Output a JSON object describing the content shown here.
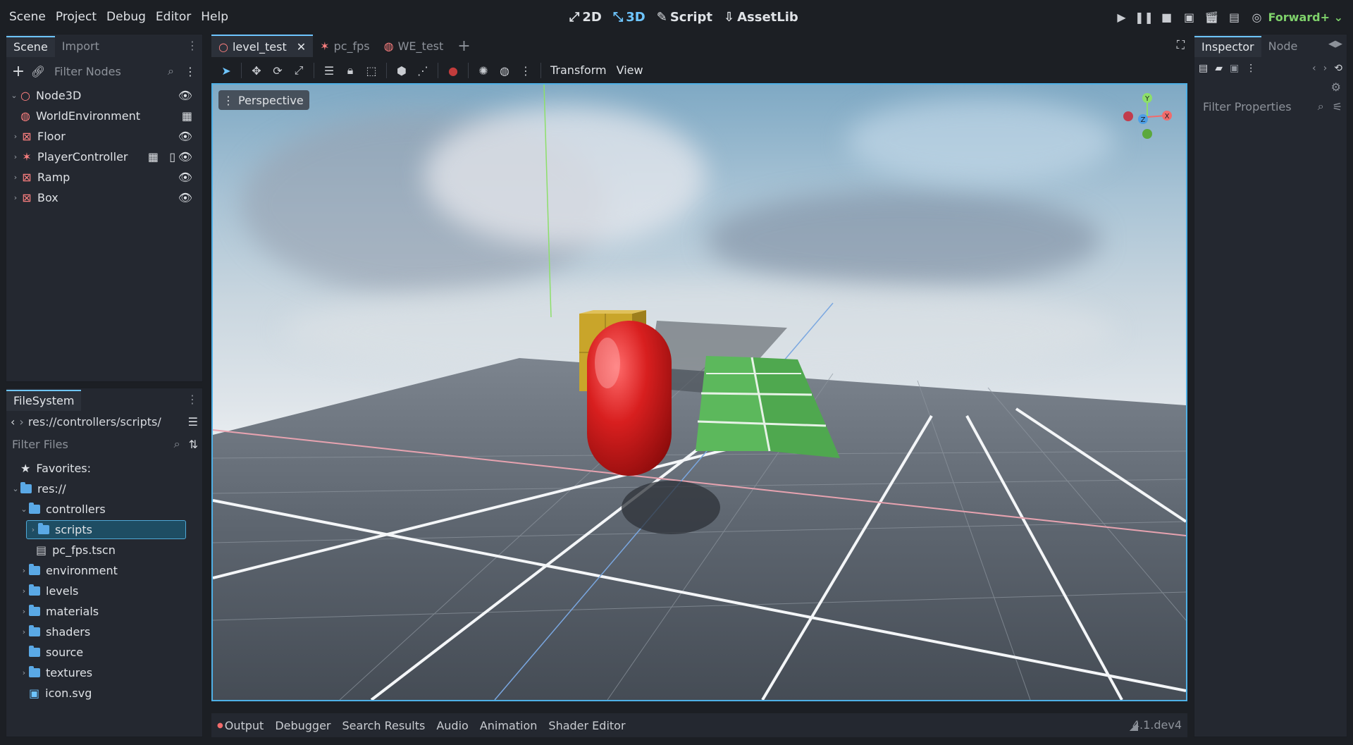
{
  "menu": [
    "Scene",
    "Project",
    "Debug",
    "Editor",
    "Help"
  ],
  "workspaces": [
    {
      "label": "2D",
      "active": false
    },
    {
      "label": "3D",
      "active": true
    },
    {
      "label": "Script",
      "active": false
    },
    {
      "label": "AssetLib",
      "active": false
    }
  ],
  "renderer": "Forward+",
  "scene_dock": {
    "tabs": [
      "Scene",
      "Import"
    ],
    "filter_placeholder": "Filter Nodes",
    "nodes": [
      {
        "label": "Node3D",
        "icon": "node3d-icon"
      },
      {
        "label": "WorldEnvironment",
        "icon": "world-environment-icon"
      },
      {
        "label": "Floor",
        "icon": "mesh-instance-icon"
      },
      {
        "label": "PlayerController",
        "icon": "character-body-icon"
      },
      {
        "label": "Ramp",
        "icon": "mesh-instance-icon"
      },
      {
        "label": "Box",
        "icon": "mesh-instance-icon"
      }
    ]
  },
  "filesystem": {
    "title": "FileSystem",
    "path": "res://controllers/scripts/",
    "filter_placeholder": "Filter Files",
    "favorites": "Favorites:",
    "root": "res://",
    "items": [
      {
        "label": "controllers",
        "type": "folder"
      },
      {
        "label": "scripts",
        "type": "folder",
        "selected": true
      },
      {
        "label": "pc_fps.tscn",
        "type": "scene"
      },
      {
        "label": "environment",
        "type": "folder"
      },
      {
        "label": "levels",
        "type": "folder"
      },
      {
        "label": "materials",
        "type": "folder"
      },
      {
        "label": "shaders",
        "type": "folder"
      },
      {
        "label": "source",
        "type": "folder"
      },
      {
        "label": "textures",
        "type": "folder"
      },
      {
        "label": "icon.svg",
        "type": "image"
      }
    ]
  },
  "editor_tabs": [
    {
      "label": "level_test",
      "active": true
    },
    {
      "label": "pc_fps",
      "active": false
    },
    {
      "label": "WE_test",
      "active": false
    }
  ],
  "toolbar": {
    "transform": "Transform",
    "view": "View"
  },
  "viewport": {
    "perspective_label": "Perspective",
    "gizmo": {
      "y": "Y",
      "z": "Z",
      "x": "X"
    }
  },
  "inspector": {
    "tabs": [
      "Inspector",
      "Node"
    ],
    "filter_placeholder": "Filter Properties"
  },
  "bottom_tabs": [
    "Output",
    "Debugger",
    "Search Results",
    "Audio",
    "Animation",
    "Shader Editor"
  ],
  "version": "4.1.dev4",
  "colors": {
    "accent": "#6ec5ff",
    "renderer": "#7fd26b",
    "capsule": "#d81f1f",
    "ramp": "#5cb85c",
    "box": "#c9a52a"
  }
}
